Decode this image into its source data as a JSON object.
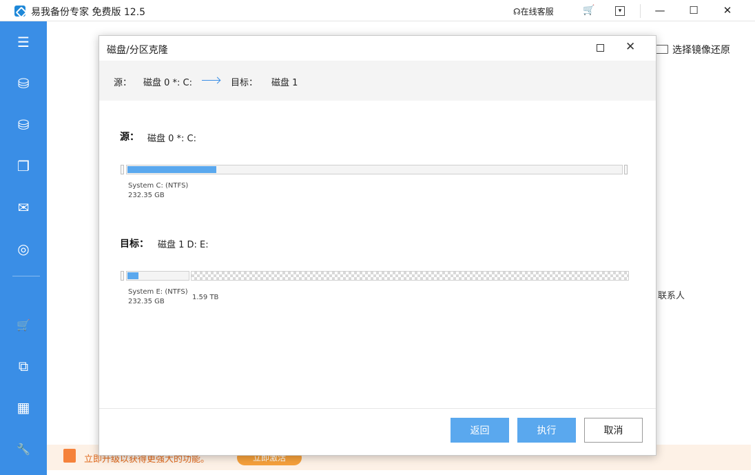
{
  "window": {
    "title": "易我备份专家 免费版 12.5",
    "online_service": "在线客服",
    "minimize_glyph": "—",
    "maximize_glyph": "☐",
    "close_glyph": "✕"
  },
  "sidebar": {
    "items": [
      {
        "icon": "menu-icon",
        "glyph": "☰"
      },
      {
        "icon": "disk-backup-icon",
        "glyph": "⛁"
      },
      {
        "icon": "system-backup-icon",
        "glyph": "⛁"
      },
      {
        "icon": "file-backup-icon",
        "glyph": "❐"
      },
      {
        "icon": "mail-backup-icon",
        "glyph": "✉"
      },
      {
        "icon": "smart-backup-icon",
        "glyph": "◎"
      },
      {
        "icon": "cart-icon",
        "glyph": "🛒"
      },
      {
        "icon": "clone-icon",
        "glyph": "⧉"
      },
      {
        "icon": "apps-icon",
        "glyph": "▦"
      },
      {
        "icon": "tools-icon",
        "glyph": "🔧"
      }
    ]
  },
  "background": {
    "restore_image": "选择镜像还原",
    "contact": "联系人"
  },
  "promo": {
    "text": "立即升级以获得更强大的功能。",
    "button": "立即激活"
  },
  "dialog": {
    "title": "磁盘/分区克隆",
    "path": {
      "source_label": "源：",
      "source_value": "磁盘 0 *: C:",
      "target_label": "目标：",
      "target_value": "磁盘 1"
    },
    "source": {
      "label": "源：",
      "disk": "磁盘 0 *: C:",
      "partitions": [
        {
          "name": "System C: (NTFS)",
          "size": "232.35 GB",
          "used_fraction": 0.18
        }
      ]
    },
    "target": {
      "label": "目标：",
      "disk": "磁盘 1 D: E:",
      "partitions": [
        {
          "name": "System E: (NTFS)",
          "size": "232.35 GB",
          "used_fraction": 0.18
        },
        {
          "name": "",
          "size": "1.59 TB",
          "unallocated": true
        }
      ]
    },
    "buttons": {
      "back": "返回",
      "execute": "执行",
      "cancel": "取消"
    }
  },
  "colors": {
    "accent": "#3a8ee6",
    "bar_fill": "#5aa8ee",
    "promo_text": "#e0691c"
  }
}
